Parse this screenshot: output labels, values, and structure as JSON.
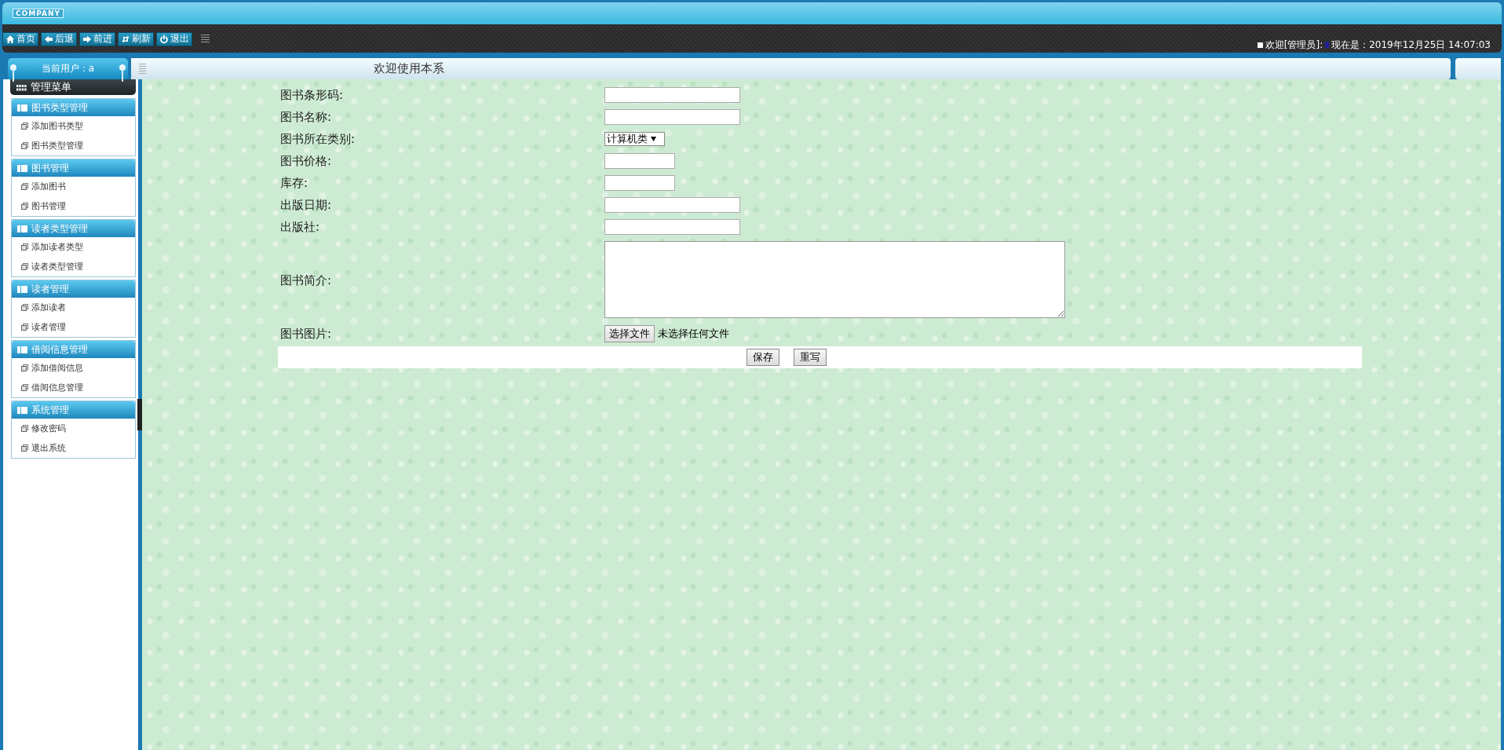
{
  "header": {
    "logo": "COMPANY",
    "toolbar": [
      {
        "kind": "home",
        "label": "首页"
      },
      {
        "kind": "back",
        "label": "后退"
      },
      {
        "kind": "forward",
        "label": "前进"
      },
      {
        "kind": "refresh",
        "label": "刷新"
      },
      {
        "kind": "logout",
        "label": "退出"
      }
    ],
    "welcome": "欢迎[管理员]:",
    "clock": "现在是：2019年12月25日 14:07:03"
  },
  "user_panel": {
    "label": "当前用户：a"
  },
  "tab": {
    "title": "欢迎使用本系"
  },
  "sidebar": {
    "title": "管理菜单",
    "groups": [
      {
        "title": "图书类型管理",
        "items": [
          "添加图书类型",
          "图书类型管理"
        ]
      },
      {
        "title": "图书管理",
        "items": [
          "添加图书",
          "图书管理"
        ]
      },
      {
        "title": "读者类型管理",
        "items": [
          "添加读者类型",
          "读者类型管理"
        ]
      },
      {
        "title": "读者管理",
        "items": [
          "添加读者",
          "读者管理"
        ]
      },
      {
        "title": "借阅信息管理",
        "items": [
          "添加借阅信息",
          "借阅信息管理"
        ]
      },
      {
        "title": "系统管理",
        "items": [
          "修改密码",
          "退出系统"
        ]
      }
    ]
  },
  "form": {
    "rows": [
      {
        "label": "图书条形码:",
        "kind": "text"
      },
      {
        "label": "图书名称:",
        "kind": "text"
      },
      {
        "label": "图书所在类别:",
        "kind": "select",
        "value": "计算机类"
      },
      {
        "label": "图书价格:",
        "kind": "short"
      },
      {
        "label": "库存:",
        "kind": "short"
      },
      {
        "label": "出版日期:",
        "kind": "text"
      },
      {
        "label": "出版社:",
        "kind": "text"
      },
      {
        "label": "图书简介:",
        "kind": "textarea"
      },
      {
        "label": "图书图片:",
        "kind": "file",
        "button": "选择文件",
        "status": "未选择任何文件"
      }
    ],
    "buttons": [
      "保存",
      "重写"
    ]
  }
}
